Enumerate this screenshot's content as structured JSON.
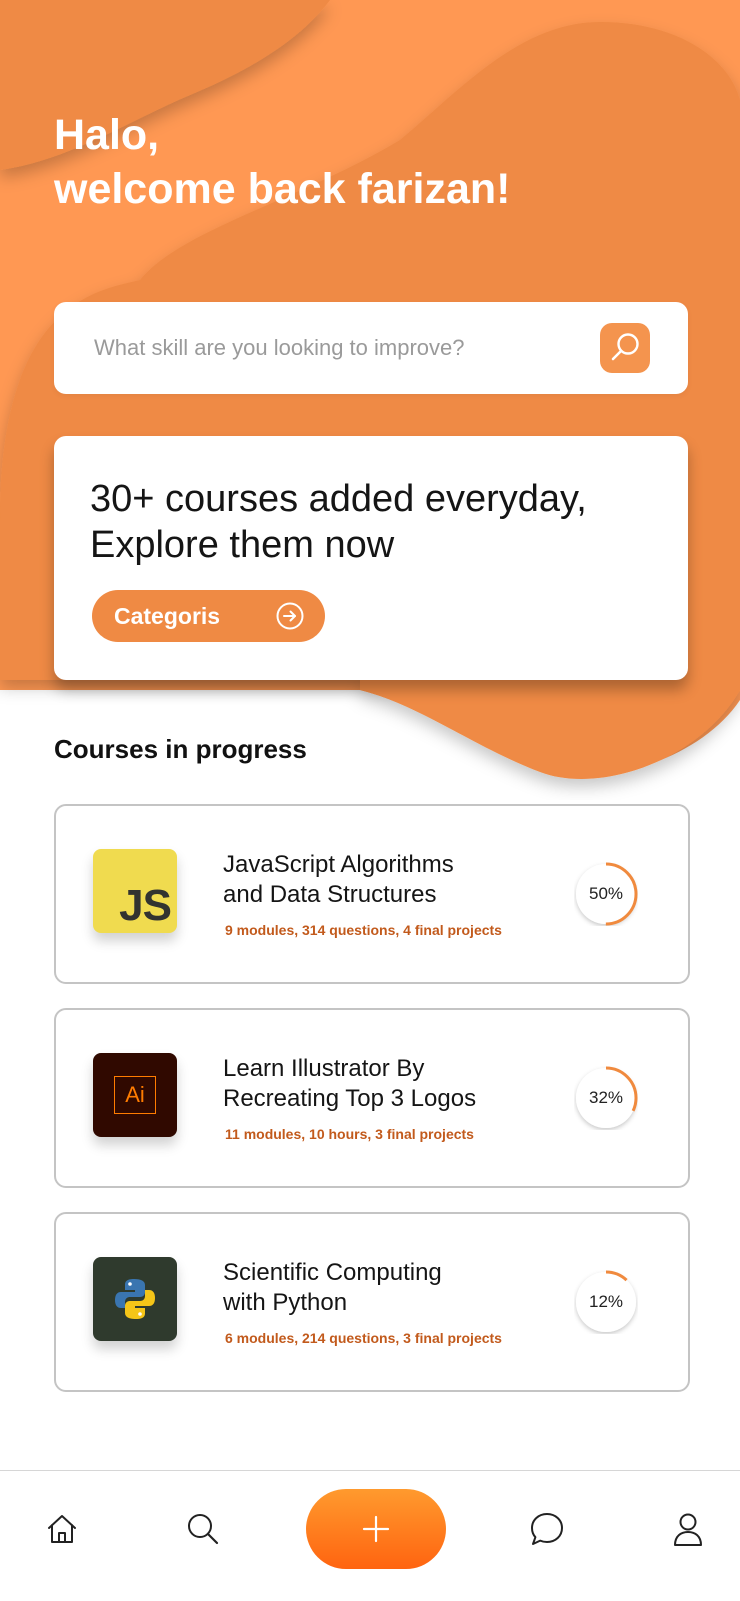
{
  "greeting": {
    "line1": "Halo,",
    "line2": "welcome back farizan!"
  },
  "search": {
    "placeholder": "What skill are you looking to improve?",
    "icon": "search-icon"
  },
  "promo": {
    "line1": "30+ courses added everyday,",
    "line2": "Explore them now",
    "button_label": "Categoris",
    "button_icon": "arrow-right-circle-icon"
  },
  "section_title": "Courses in progress",
  "courses": [
    {
      "title_line1": "JavaScript Algorithms",
      "title_line2": "and Data Structures",
      "meta": "9 modules, 314 questions, 4 final projects",
      "progress": 50,
      "progress_label": "50%",
      "icon": "javascript-logo-icon",
      "icon_text": "JS"
    },
    {
      "title_line1": "Learn Illustrator By",
      "title_line2": "Recreating Top 3 Logos",
      "meta": "11 modules, 10 hours, 3 final projects",
      "progress": 32,
      "progress_label": "32%",
      "icon": "illustrator-logo-icon",
      "icon_text": "Ai"
    },
    {
      "title_line1": "Scientific Computing",
      "title_line2": "with Python",
      "meta": "6 modules, 214 questions, 3 final projects",
      "progress": 12,
      "progress_label": "12%",
      "icon": "python-logo-icon"
    }
  ],
  "nav": {
    "items": [
      "home-icon",
      "search-icon",
      "add-icon",
      "chat-icon",
      "profile-icon"
    ]
  },
  "colors": {
    "accent": "#F4944E",
    "accent_dark": "#EF8A44",
    "meta_text": "#C25A1C",
    "progress_stroke": "#F08A3E"
  }
}
